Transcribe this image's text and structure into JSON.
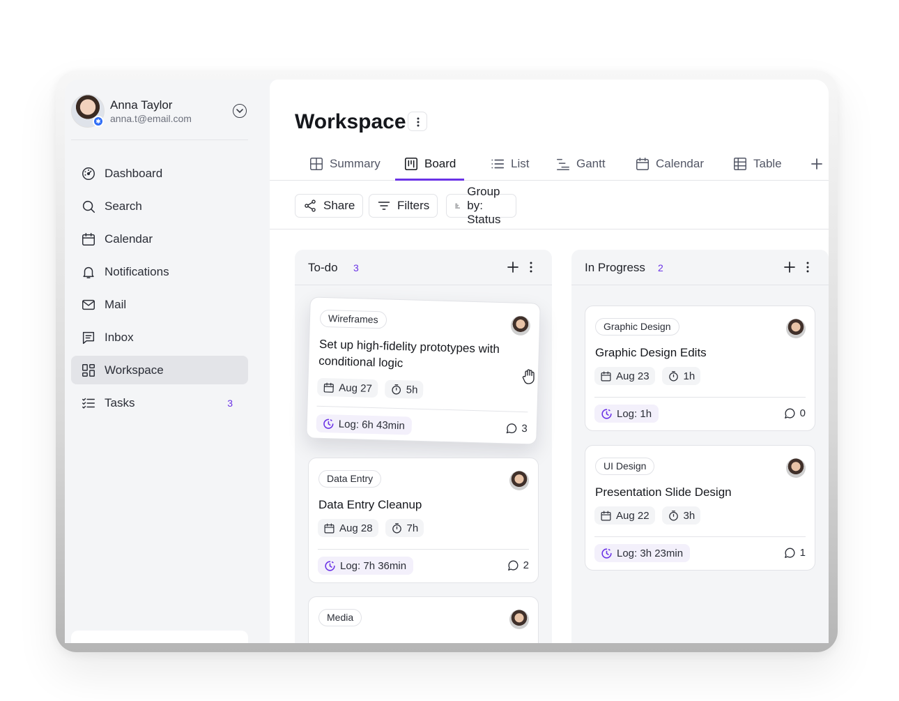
{
  "user": {
    "name": "Anna Taylor",
    "email": "anna.t@email.com"
  },
  "sidebar": {
    "items": [
      {
        "label": "Dashboard",
        "icon": "dashboard-icon"
      },
      {
        "label": "Search",
        "icon": "search-icon"
      },
      {
        "label": "Calendar",
        "icon": "calendar-icon"
      },
      {
        "label": "Notifications",
        "icon": "bell-icon"
      },
      {
        "label": "Mail",
        "icon": "mail-icon"
      },
      {
        "label": "Inbox",
        "icon": "inbox-icon"
      },
      {
        "label": "Workspace",
        "icon": "grid-icon",
        "active": true
      },
      {
        "label": "Tasks",
        "icon": "tasks-icon",
        "count": "3"
      }
    ]
  },
  "page": {
    "title": "Workspace"
  },
  "tabs": [
    {
      "label": "Summary",
      "icon": "summary-icon"
    },
    {
      "label": "Board",
      "icon": "board-icon",
      "active": true
    },
    {
      "label": "List",
      "icon": "list-icon"
    },
    {
      "label": "Gantt",
      "icon": "gantt-icon"
    },
    {
      "label": "Calendar",
      "icon": "calendar-icon"
    },
    {
      "label": "Table",
      "icon": "table-icon"
    }
  ],
  "toolbar": {
    "share": "Share",
    "filters": "Filters",
    "group_by": "Group by: Status"
  },
  "columns": [
    {
      "title": "To-do",
      "count": "3",
      "cards": [
        {
          "tag": "Wireframes",
          "title": "Set up high-fidelity prototypes with conditional logic",
          "date": "Aug 27",
          "estimate": "5h",
          "log": "Log: 6h 43min",
          "comments": "3"
        },
        {
          "tag": "Data Entry",
          "title": "Data Entry Cleanup",
          "date": "Aug 28",
          "estimate": "7h",
          "log": "Log: 7h 36min",
          "comments": "2"
        },
        {
          "tag": "Media"
        }
      ]
    },
    {
      "title": "In Progress",
      "count": "2",
      "cards": [
        {
          "tag": "Graphic Design",
          "title": "Graphic Design Edits",
          "date": "Aug 23",
          "estimate": "1h",
          "log": "Log: 1h",
          "comments": "0"
        },
        {
          "tag": "UI Design",
          "title": "Presentation Slide Design",
          "date": "Aug 22",
          "estimate": "3h",
          "log": "Log: 3h 23min",
          "comments": "1"
        }
      ]
    }
  ],
  "colors": {
    "accent": "#6a32e6",
    "badge": "#2f6df6",
    "active_nav": "#e3e4e8"
  }
}
